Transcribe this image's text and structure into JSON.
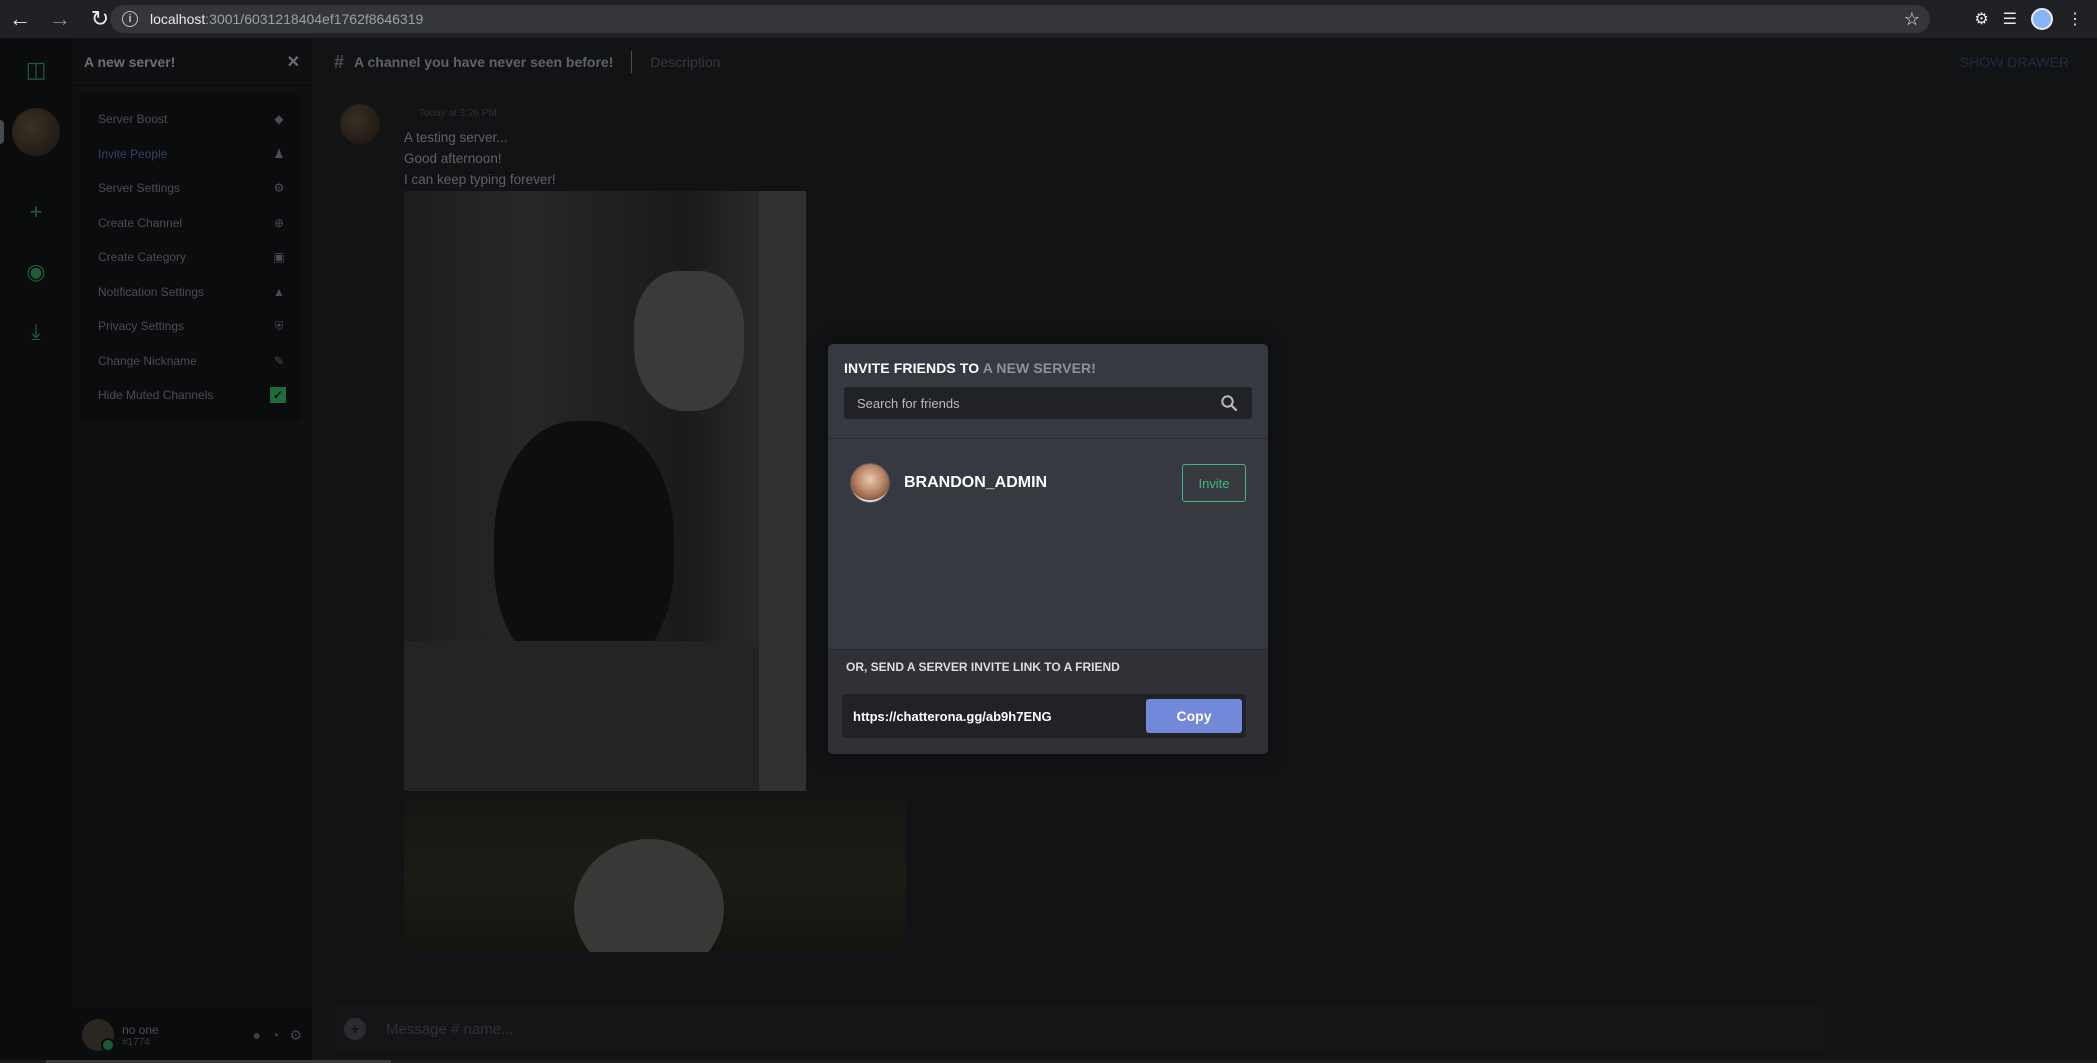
{
  "browser": {
    "url_host": "localhost",
    "url_rest": ":3001/6031218404ef1762f8646319"
  },
  "server": {
    "name": "A new server!",
    "menu": [
      {
        "label": "Server Boost",
        "icon": "gem-icon"
      },
      {
        "label": "Invite People",
        "icon": "add-user-icon"
      },
      {
        "label": "Server Settings",
        "icon": "gear-icon"
      },
      {
        "label": "Create Channel",
        "icon": "plus-circle-icon"
      },
      {
        "label": "Create Category",
        "icon": "folder-icon"
      },
      {
        "label": "Notification Settings",
        "icon": "bell-icon"
      },
      {
        "label": "Privacy Settings",
        "icon": "shield-icon"
      },
      {
        "label": "Change Nickname",
        "icon": "pencil-icon"
      },
      {
        "label": "Hide Muted Channels",
        "icon": "checkbox-checked"
      }
    ]
  },
  "channel": {
    "name": "A channel you have never seen before!",
    "description": "Description",
    "show_drawer": "SHOW DRAWER"
  },
  "message": {
    "timestamp": "Today at 3:26 PM",
    "lines": [
      "A testing server...",
      "Good afternoon!",
      "I can keep typing forever!"
    ]
  },
  "composer": {
    "placeholder": "Message # name..."
  },
  "user": {
    "name": "no one",
    "tag": "#1774"
  },
  "modal": {
    "title_prefix": "INVITE FRIENDS TO ",
    "title_server": "A NEW SERVER!",
    "search_placeholder": "Search for friends",
    "friends": [
      {
        "name": "BRANDON_ADMIN",
        "action": "Invite"
      }
    ],
    "link_label": "OR, SEND A SERVER INVITE LINK TO A FRIEND",
    "invite_link": "https://chatterona.gg/ab9h7ENG",
    "copy_label": "Copy"
  },
  "colors": {
    "accent": "#7289da",
    "invite_green": "#43b581",
    "modal_bg": "#36393f"
  }
}
